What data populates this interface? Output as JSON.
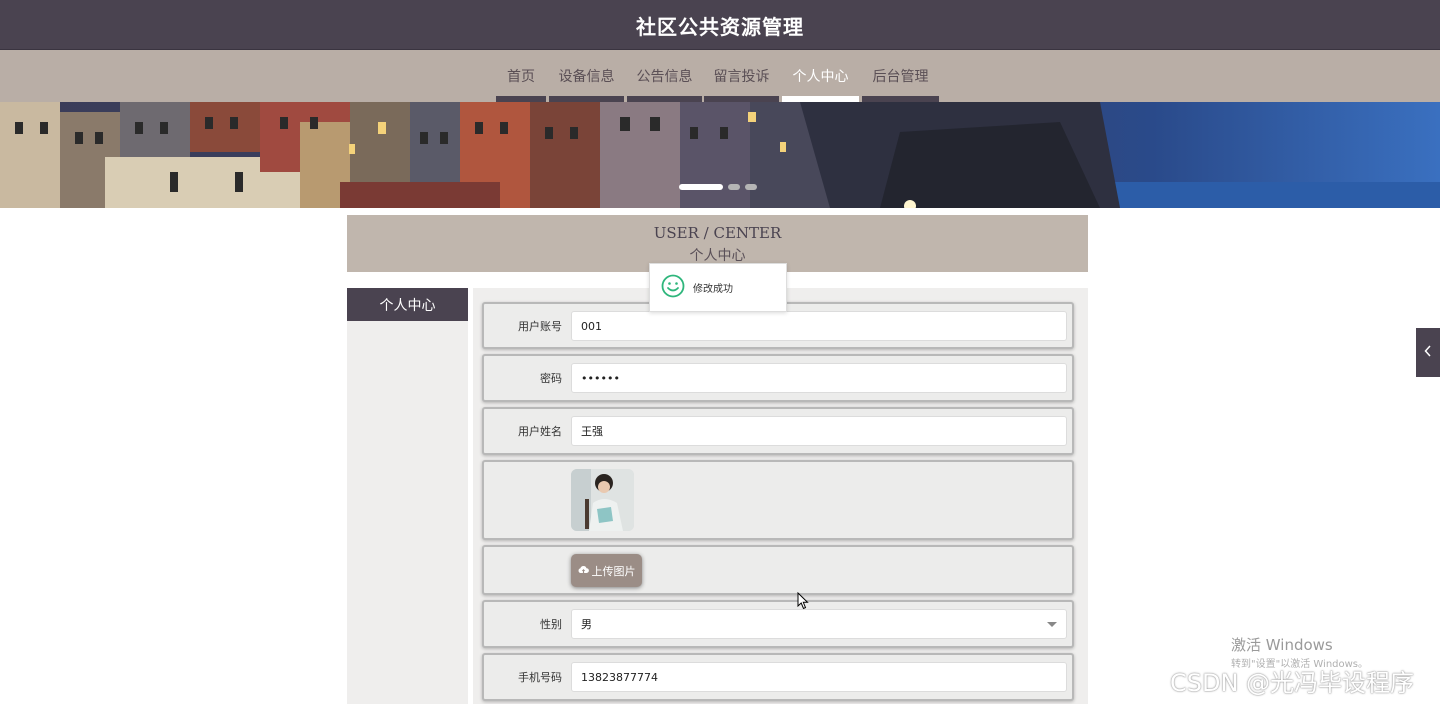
{
  "header": {
    "title": "社区公共资源管理"
  },
  "nav": {
    "items": [
      {
        "label": "首页"
      },
      {
        "label": "设备信息"
      },
      {
        "label": "公告信息"
      },
      {
        "label": "留言投诉"
      },
      {
        "label": "个人中心",
        "active": true
      },
      {
        "label": "后台管理"
      }
    ]
  },
  "banner": {
    "slide_count": 3,
    "active_slide": 1
  },
  "section": {
    "title_en": "USER / CENTER",
    "title_cn": "个人中心"
  },
  "sidebar": {
    "tab_label": "个人中心"
  },
  "toast": {
    "message": "修改成功",
    "icon": "smile-icon"
  },
  "form": {
    "account_label": "用户账号",
    "account_value": "001",
    "password_label": "密码",
    "password_value": "••••••",
    "name_label": "用户姓名",
    "name_value": "王强",
    "upload_label": "上传图片",
    "gender_label": "性别",
    "gender_value": "男",
    "phone_label": "手机号码",
    "phone_value": "13823877774"
  },
  "watermarks": {
    "windows_title": "激活 Windows",
    "windows_sub": "转到\"设置\"以激活 Windows。",
    "csdn": "CSDN @光冯毕设程序"
  },
  "colors": {
    "header_bg": "#4a4350",
    "nav_bg": "#b9aea6",
    "section_head_bg": "#c0b6ad",
    "upload_btn_bg": "#9b8d86",
    "toast_icon": "#2fb67c"
  }
}
